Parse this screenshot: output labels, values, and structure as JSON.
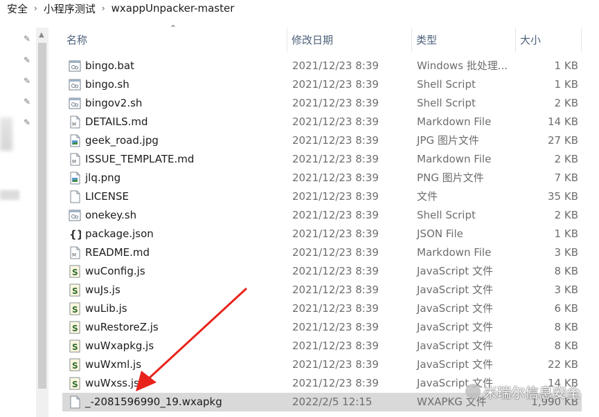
{
  "breadcrumb": [
    "安全",
    "小程序测试",
    "wxappUnpacker-master"
  ],
  "columns": {
    "name": "名称",
    "date": "修改日期",
    "type": "类型",
    "size": "大小"
  },
  "files": [
    {
      "name": "bingo.bat",
      "date": "2021/12/23 8:39",
      "type": "Windows 批处理...",
      "size": "1 KB",
      "icon": "batch-file-icon"
    },
    {
      "name": "bingo.sh",
      "date": "2021/12/23 8:39",
      "type": "Shell Script",
      "size": "1 KB",
      "icon": "shell-script-icon"
    },
    {
      "name": "bingov2.sh",
      "date": "2021/12/23 8:39",
      "type": "Shell Script",
      "size": "2 KB",
      "icon": "shell-script-icon"
    },
    {
      "name": "DETAILS.md",
      "date": "2021/12/23 8:39",
      "type": "Markdown File",
      "size": "14 KB",
      "icon": "markdown-file-icon"
    },
    {
      "name": "geek_road.jpg",
      "date": "2021/12/23 8:39",
      "type": "JPG 图片文件",
      "size": "27 KB",
      "icon": "image-file-icon"
    },
    {
      "name": "ISSUE_TEMPLATE.md",
      "date": "2021/12/23 8:39",
      "type": "Markdown File",
      "size": "2 KB",
      "icon": "markdown-file-icon"
    },
    {
      "name": "jlq.png",
      "date": "2021/12/23 8:39",
      "type": "PNG 图片文件",
      "size": "7 KB",
      "icon": "image-file-icon"
    },
    {
      "name": "LICENSE",
      "date": "2021/12/23 8:39",
      "type": "文件",
      "size": "35 KB",
      "icon": "blank-file-icon"
    },
    {
      "name": "onekey.sh",
      "date": "2021/12/23 8:39",
      "type": "Shell Script",
      "size": "2 KB",
      "icon": "shell-script-icon"
    },
    {
      "name": "package.json",
      "date": "2021/12/23 8:39",
      "type": "JSON File",
      "size": "1 KB",
      "icon": "json-file-icon"
    },
    {
      "name": "README.md",
      "date": "2021/12/23 8:39",
      "type": "Markdown File",
      "size": "3 KB",
      "icon": "markdown-file-icon"
    },
    {
      "name": "wuConfig.js",
      "date": "2021/12/23 8:39",
      "type": "JavaScript 文件",
      "size": "8 KB",
      "icon": "javascript-file-icon"
    },
    {
      "name": "wuJs.js",
      "date": "2021/12/23 8:39",
      "type": "JavaScript 文件",
      "size": "3 KB",
      "icon": "javascript-file-icon"
    },
    {
      "name": "wuLib.js",
      "date": "2021/12/23 8:39",
      "type": "JavaScript 文件",
      "size": "6 KB",
      "icon": "javascript-file-icon"
    },
    {
      "name": "wuRestoreZ.js",
      "date": "2021/12/23 8:39",
      "type": "JavaScript 文件",
      "size": "8 KB",
      "icon": "javascript-file-icon"
    },
    {
      "name": "wuWxapkg.js",
      "date": "2021/12/23 8:39",
      "type": "JavaScript 文件",
      "size": "8 KB",
      "icon": "javascript-file-icon"
    },
    {
      "name": "wuWxml.js",
      "date": "2021/12/23 8:39",
      "type": "JavaScript 文件",
      "size": "22 KB",
      "icon": "javascript-file-icon"
    },
    {
      "name": "wuWxss.js",
      "date": "2021/12/23 8:39",
      "type": "JavaScript 文件",
      "size": "14 KB",
      "icon": "javascript-file-icon"
    },
    {
      "name": "_-2081596990_19.wxapkg",
      "date": "2022/2/5 12:15",
      "type": "WXAPKG 文件",
      "size": "1,990 KB",
      "icon": "blank-file-icon",
      "selected": true
    }
  ],
  "watermark": "米瑞尔信息安全",
  "colors": {
    "header_text": "#4c607a",
    "secondary_text": "#6d6d6d",
    "selected_row": "#d9d9d9",
    "annotation_arrow": "#e8231b"
  }
}
